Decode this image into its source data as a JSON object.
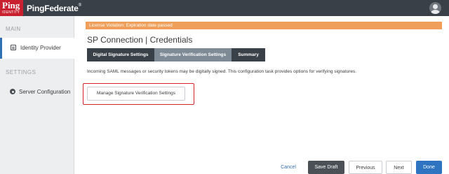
{
  "header": {
    "logo_text": "Ping",
    "logo_subtext": "IDENTITY",
    "product_name": "PingFederate",
    "trademark": "®"
  },
  "sidebar": {
    "main_label": "MAIN",
    "settings_label": "SETTINGS",
    "items": [
      {
        "label": "Identity Provider",
        "icon": "id-card-icon",
        "active": true
      },
      {
        "label": "Server Configuration",
        "icon": "gear-icon",
        "active": false
      }
    ]
  },
  "alert": {
    "text": "License Violation: Expiration date passed",
    "color": "#ef9f5a"
  },
  "page": {
    "title": "SP Connection | Credentials",
    "tabs": [
      {
        "label": "Digital Signature Settings",
        "state": "default"
      },
      {
        "label": "Signature Verification Settings",
        "state": "active"
      },
      {
        "label": "Summary",
        "state": "default"
      }
    ],
    "description": "Incoming SAML messages or security tokens may be digitally signed. This configuration task provides options for verifying signatures.",
    "manage_button": "Manage Signature Verification Settings"
  },
  "footer": {
    "cancel": "Cancel",
    "save_draft": "Save Draft",
    "previous": "Previous",
    "next": "Next",
    "done": "Done"
  },
  "colors": {
    "topbar": "#3a4047",
    "brand_red": "#c8202f",
    "highlight_red": "#d7232b",
    "primary_blue": "#2f74c0"
  }
}
